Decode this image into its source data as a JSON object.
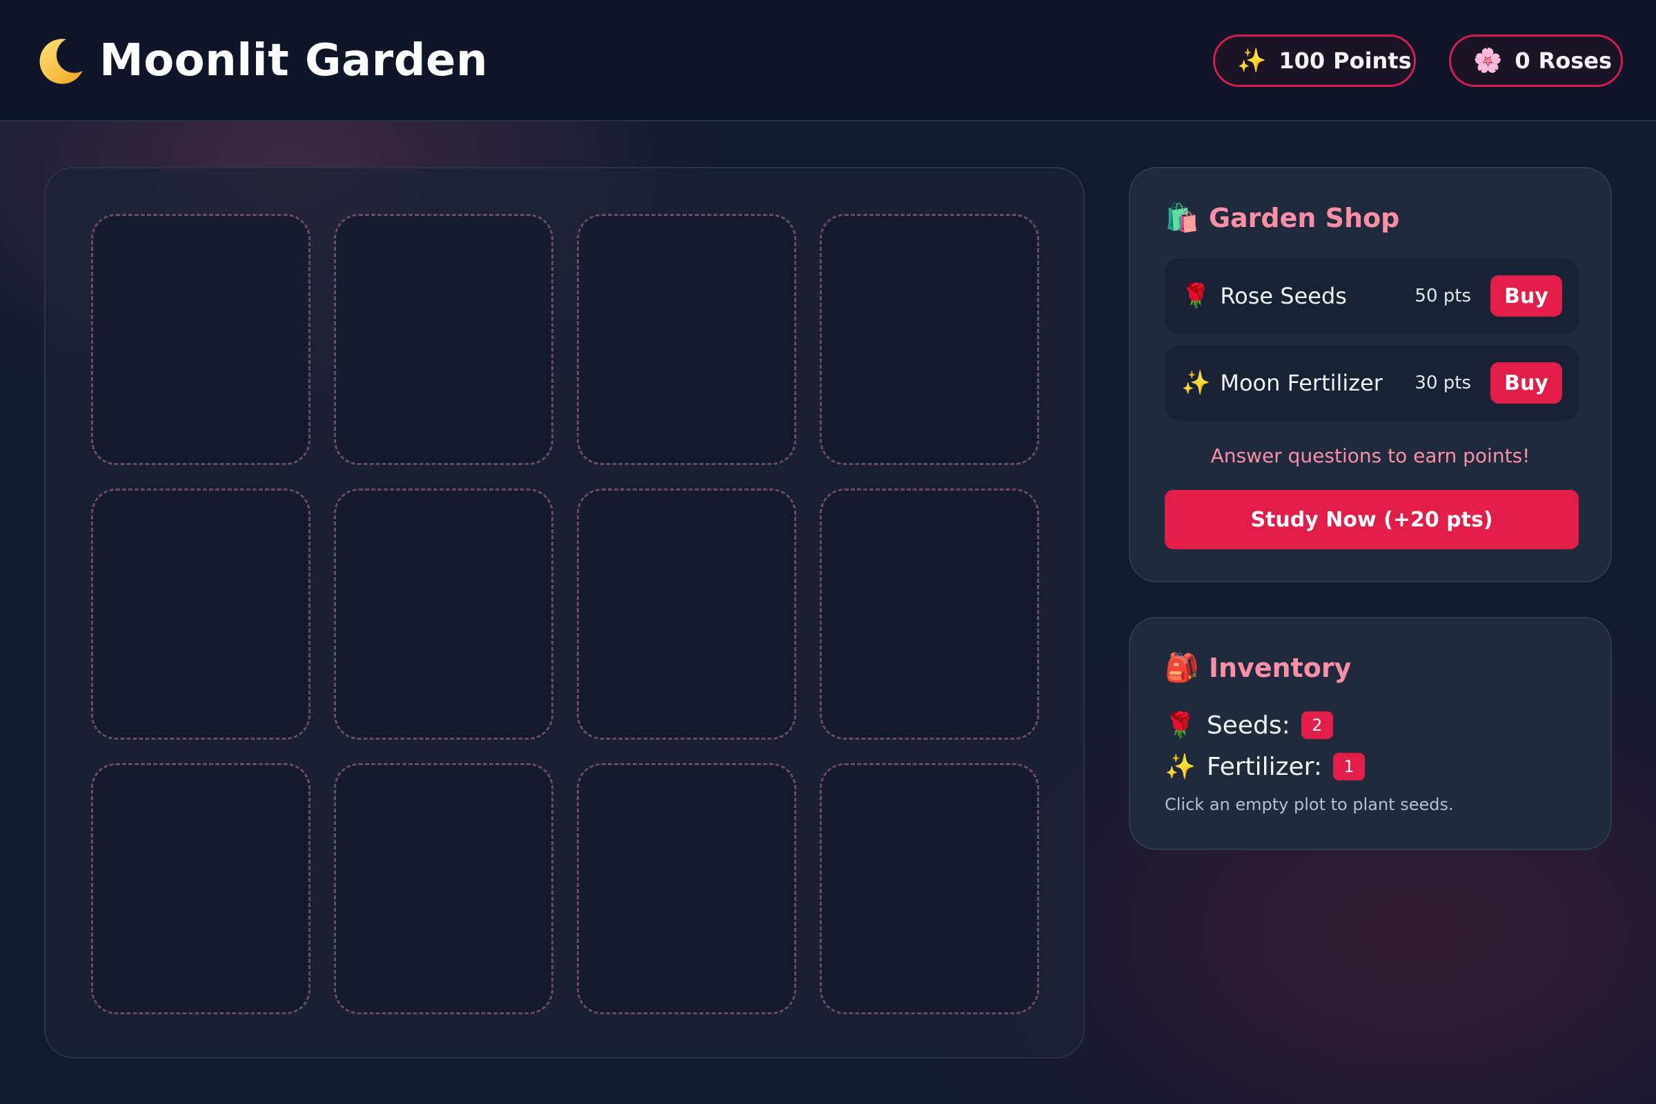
{
  "header": {
    "title": "Moonlit Garden",
    "logo_icon": "crescent-moon-icon",
    "points_icon": "✨",
    "points_value": "100",
    "points_label": "Points",
    "roses_icon": "🌸",
    "roses_value": "0",
    "roses_label": "Roses"
  },
  "garden": {
    "rows": 3,
    "columns": 4,
    "plots": [
      "empty",
      "empty",
      "empty",
      "empty",
      "empty",
      "empty",
      "empty",
      "empty",
      "empty",
      "empty",
      "empty",
      "empty"
    ]
  },
  "shop": {
    "icon": "🛍️",
    "title": "Garden Shop",
    "items": [
      {
        "icon": "🌹",
        "name": "Rose Seeds",
        "price": "50 pts",
        "buy_label": "Buy"
      },
      {
        "icon": "✨",
        "name": "Moon Fertilizer",
        "price": "30 pts",
        "buy_label": "Buy"
      }
    ],
    "hint": "Answer questions to earn points!",
    "study_label": "Study Now (+20 pts)"
  },
  "inventory": {
    "icon": "🎒",
    "title": "Inventory",
    "seeds_icon": "🌹",
    "seeds_label": "Seeds:",
    "seeds_count": "2",
    "fertilizer_icon": "✨",
    "fertilizer_label": "Fertilizer:",
    "fertilizer_count": "1",
    "hint": "Click an empty plot to plant seeds."
  },
  "colors": {
    "accent": "#e11d48",
    "accent_text": "#ff8fa6",
    "background": "#121a2e",
    "panel": "#1f2a3d",
    "plot_border": "#6b4a66"
  }
}
